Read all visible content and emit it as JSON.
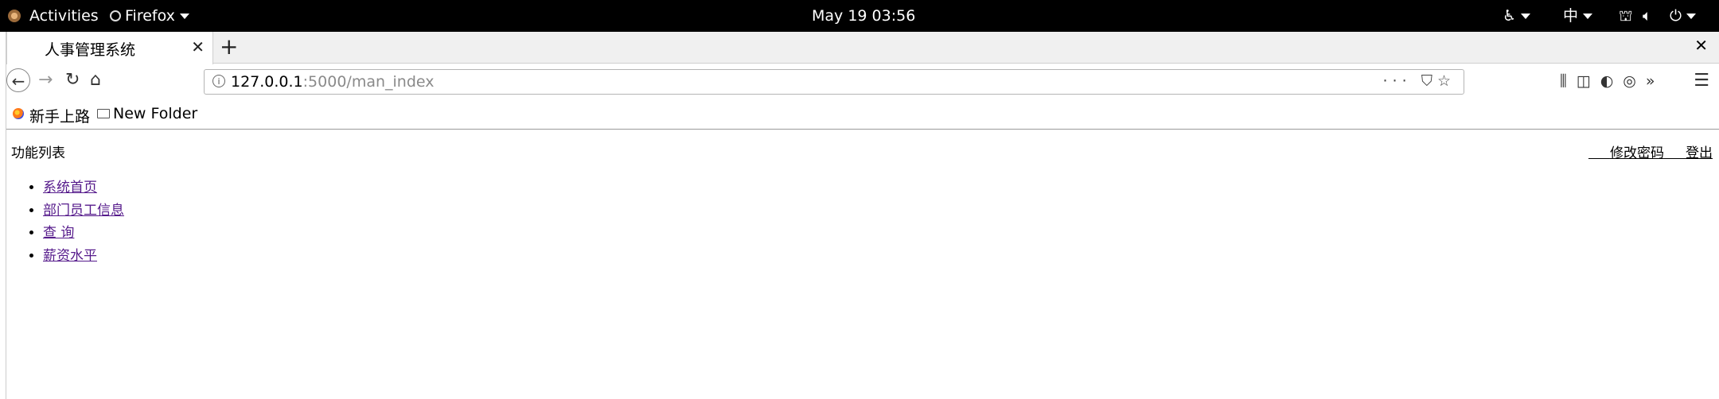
{
  "topbar": {
    "activities": "Activities",
    "app_name": "Firefox",
    "clock": "May 19  03:56",
    "input_method": "中"
  },
  "browser": {
    "tab_title": "人事管理系统",
    "url_host": "127.0.0.1",
    "url_rest": ":5000/man_index",
    "bookmarks": [
      "新手上路",
      "New Folder"
    ]
  },
  "page": {
    "function_list_title": "功能列表",
    "change_password": "修改密码",
    "logout": "登出",
    "menu_items": [
      "系统首页",
      "部门员工信息",
      "查 询",
      "薪资水平"
    ]
  },
  "colors": {
    "visited_link": "#551a8b",
    "topbar_bg": "#000000"
  }
}
